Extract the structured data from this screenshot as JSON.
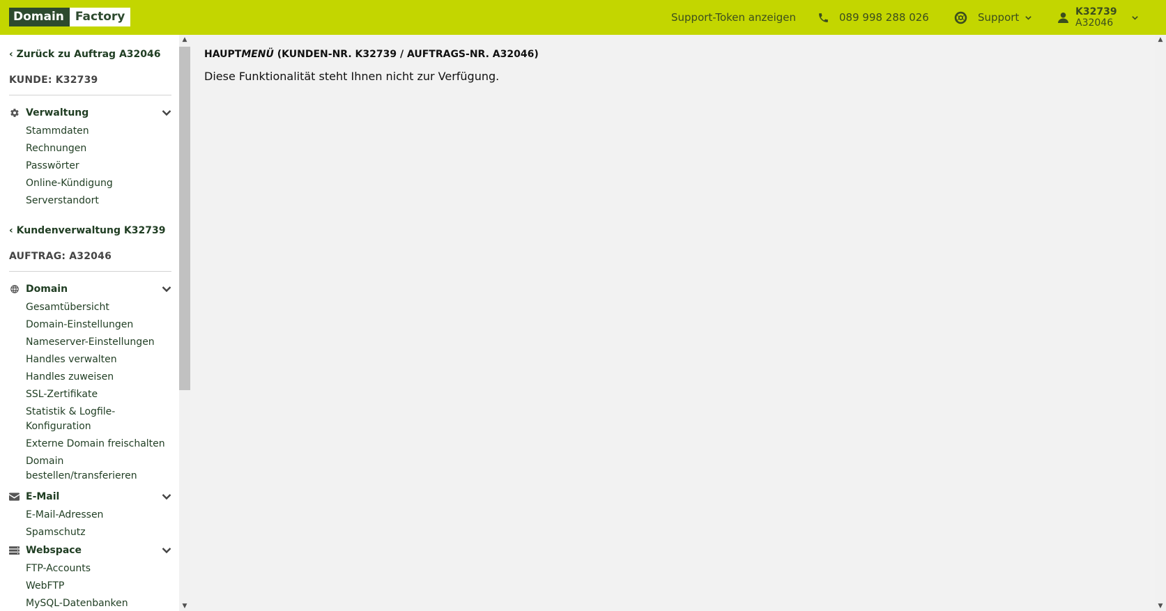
{
  "header": {
    "logo_left": "Domain",
    "logo_right": "Factory",
    "support_token": "Support-Token anzeigen",
    "phone": "089 998 288 026",
    "support": "Support",
    "user_id": "K32739",
    "order_id": "A32046"
  },
  "sidebar": {
    "back_order": "‹ Zurück zu Auftrag A32046",
    "customer_label": "KUNDE: K32739",
    "admin_group": {
      "label": "Verwaltung",
      "items": [
        "Stammdaten",
        "Rechnungen",
        "Passwörter",
        "Online-Kündigung",
        "Serverstandort"
      ]
    },
    "back_customer": "‹ Kundenverwaltung K32739",
    "order_label": "AUFTRAG: A32046",
    "domain_group": {
      "label": "Domain",
      "items": [
        "Gesamtübersicht",
        "Domain-Einstellungen",
        "Nameserver-Einstellungen",
        "Handles verwalten",
        "Handles zuweisen",
        "SSL-Zertifikate",
        "Statistik & Logfile-Konfiguration",
        "Externe Domain freischalten",
        "Domain bestellen/transferieren"
      ]
    },
    "email_group": {
      "label": "E-Mail",
      "items": [
        "E-Mail-Adressen",
        "Spamschutz"
      ]
    },
    "webspace_group": {
      "label": "Webspace",
      "items": [
        "FTP-Accounts",
        "WebFTP",
        "MySQL-Datenbanken"
      ]
    }
  },
  "main": {
    "heading_prefix": "HAUPT",
    "heading_italic": "MENÜ",
    "heading_suffix": " (KUNDEN-NR. K32739 / AUFTRAGS-NR. A32046)",
    "message": "Diese Funktionalität steht Ihnen nicht zur Verfügung."
  },
  "colors": {
    "brand": "#c3d600",
    "brand_dark": "#2d4a2e"
  }
}
